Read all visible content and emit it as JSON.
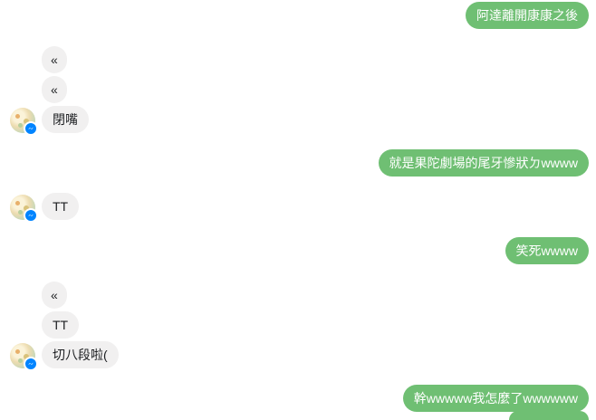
{
  "messages": {
    "m1": "阿達離開康康之後",
    "m2": "«",
    "m3": "«",
    "m4": "閉嘴",
    "m5": "就是果陀劇場的尾牙慘狀ㄉwwww",
    "m6": "TT",
    "m7": "笑死wwww",
    "m8": "«",
    "m9": "TT",
    "m10": "切八段啦(",
    "m11": "幹wwwww我怎麼了wwwwww"
  },
  "colors": {
    "outgoing_bubble": "#6fbf73",
    "incoming_bubble": "#f1f0f0",
    "messenger_badge": "#0084ff"
  },
  "icons": {
    "avatar": "contact-avatar",
    "badge": "messenger-badge-icon"
  }
}
